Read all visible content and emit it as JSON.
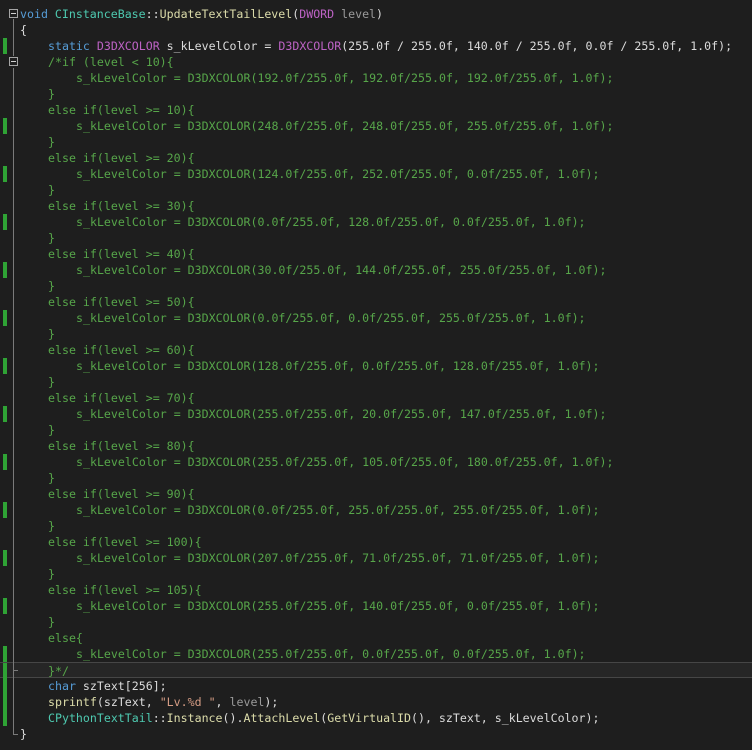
{
  "editor": {
    "lines": [
      {
        "indent": 0,
        "bar": false,
        "fold": "open",
        "tokens": [
          [
            "kw",
            "void"
          ],
          [
            "plain",
            " "
          ],
          [
            "type",
            "CInstanceBase"
          ],
          [
            "plain",
            "::"
          ],
          [
            "fn",
            "UpdateTextTailLevel"
          ],
          [
            "plain",
            "("
          ],
          [
            "mac",
            "DWORD"
          ],
          [
            "plain",
            " "
          ],
          [
            "prm",
            "level"
          ],
          [
            "plain",
            ")"
          ]
        ]
      },
      {
        "indent": 0,
        "bar": false,
        "tokens": [
          [
            "plain",
            "{"
          ]
        ]
      },
      {
        "indent": 1,
        "bar": true,
        "tokens": [
          [
            "kw",
            "static"
          ],
          [
            "plain",
            " "
          ],
          [
            "mac",
            "D3DXCOLOR"
          ],
          [
            "plain",
            " s_kLevelColor = "
          ],
          [
            "mac",
            "D3DXCOLOR"
          ],
          [
            "plain",
            "(255.0f / 255.0f, 140.0f / 255.0f, 0.0f / 255.0f, 1.0f);"
          ]
        ]
      },
      {
        "indent": 1,
        "bar": false,
        "fold": "open",
        "tokens": [
          [
            "cm",
            "/*if (level < 10){"
          ]
        ]
      },
      {
        "indent": 2,
        "bar": false,
        "tokens": [
          [
            "cm",
            "s_kLevelColor = D3DXCOLOR(192.0f/255.0f, 192.0f/255.0f, 192.0f/255.0f, 1.0f);"
          ]
        ]
      },
      {
        "indent": 1,
        "bar": false,
        "tokens": [
          [
            "cm",
            "}"
          ]
        ]
      },
      {
        "indent": 1,
        "bar": false,
        "tokens": [
          [
            "cm",
            "else if(level >= 10){"
          ]
        ]
      },
      {
        "indent": 2,
        "bar": true,
        "tokens": [
          [
            "cm",
            "s_kLevelColor = D3DXCOLOR(248.0f/255.0f, 248.0f/255.0f, 255.0f/255.0f, 1.0f);"
          ]
        ]
      },
      {
        "indent": 1,
        "bar": false,
        "tokens": [
          [
            "cm",
            "}"
          ]
        ]
      },
      {
        "indent": 1,
        "bar": false,
        "tokens": [
          [
            "cm",
            "else if(level >= 20){"
          ]
        ]
      },
      {
        "indent": 2,
        "bar": true,
        "tokens": [
          [
            "cm",
            "s_kLevelColor = D3DXCOLOR(124.0f/255.0f, 252.0f/255.0f, 0.0f/255.0f, 1.0f);"
          ]
        ]
      },
      {
        "indent": 1,
        "bar": false,
        "tokens": [
          [
            "cm",
            "}"
          ]
        ]
      },
      {
        "indent": 1,
        "bar": false,
        "tokens": [
          [
            "cm",
            "else if(level >= 30){"
          ]
        ]
      },
      {
        "indent": 2,
        "bar": true,
        "tokens": [
          [
            "cm",
            "s_kLevelColor = D3DXCOLOR(0.0f/255.0f, 128.0f/255.0f, 0.0f/255.0f, 1.0f);"
          ]
        ]
      },
      {
        "indent": 1,
        "bar": false,
        "tokens": [
          [
            "cm",
            "}"
          ]
        ]
      },
      {
        "indent": 1,
        "bar": false,
        "tokens": [
          [
            "cm",
            "else if(level >= 40){"
          ]
        ]
      },
      {
        "indent": 2,
        "bar": true,
        "tokens": [
          [
            "cm",
            "s_kLevelColor = D3DXCOLOR(30.0f/255.0f, 144.0f/255.0f, 255.0f/255.0f, 1.0f);"
          ]
        ]
      },
      {
        "indent": 1,
        "bar": false,
        "tokens": [
          [
            "cm",
            "}"
          ]
        ]
      },
      {
        "indent": 1,
        "bar": false,
        "tokens": [
          [
            "cm",
            "else if(level >= 50){"
          ]
        ]
      },
      {
        "indent": 2,
        "bar": true,
        "tokens": [
          [
            "cm",
            "s_kLevelColor = D3DXCOLOR(0.0f/255.0f, 0.0f/255.0f, 255.0f/255.0f, 1.0f);"
          ]
        ]
      },
      {
        "indent": 1,
        "bar": false,
        "tokens": [
          [
            "cm",
            "}"
          ]
        ]
      },
      {
        "indent": 1,
        "bar": false,
        "tokens": [
          [
            "cm",
            "else if(level >= 60){"
          ]
        ]
      },
      {
        "indent": 2,
        "bar": true,
        "tokens": [
          [
            "cm",
            "s_kLevelColor = D3DXCOLOR(128.0f/255.0f, 0.0f/255.0f, 128.0f/255.0f, 1.0f);"
          ]
        ]
      },
      {
        "indent": 1,
        "bar": false,
        "tokens": [
          [
            "cm",
            "}"
          ]
        ]
      },
      {
        "indent": 1,
        "bar": false,
        "tokens": [
          [
            "cm",
            "else if(level >= 70){"
          ]
        ]
      },
      {
        "indent": 2,
        "bar": true,
        "tokens": [
          [
            "cm",
            "s_kLevelColor = D3DXCOLOR(255.0f/255.0f, 20.0f/255.0f, 147.0f/255.0f, 1.0f);"
          ]
        ]
      },
      {
        "indent": 1,
        "bar": false,
        "tokens": [
          [
            "cm",
            "}"
          ]
        ]
      },
      {
        "indent": 1,
        "bar": false,
        "tokens": [
          [
            "cm",
            "else if(level >= 80){"
          ]
        ]
      },
      {
        "indent": 2,
        "bar": true,
        "tokens": [
          [
            "cm",
            "s_kLevelColor = D3DXCOLOR(255.0f/255.0f, 105.0f/255.0f, 180.0f/255.0f, 1.0f);"
          ]
        ]
      },
      {
        "indent": 1,
        "bar": false,
        "tokens": [
          [
            "cm",
            "}"
          ]
        ]
      },
      {
        "indent": 1,
        "bar": false,
        "tokens": [
          [
            "cm",
            "else if(level >= 90){"
          ]
        ]
      },
      {
        "indent": 2,
        "bar": true,
        "tokens": [
          [
            "cm",
            "s_kLevelColor = D3DXCOLOR(0.0f/255.0f, 255.0f/255.0f, 255.0f/255.0f, 1.0f);"
          ]
        ]
      },
      {
        "indent": 1,
        "bar": false,
        "tokens": [
          [
            "cm",
            "}"
          ]
        ]
      },
      {
        "indent": 1,
        "bar": false,
        "tokens": [
          [
            "cm",
            "else if(level >= 100){"
          ]
        ]
      },
      {
        "indent": 2,
        "bar": true,
        "tokens": [
          [
            "cm",
            "s_kLevelColor = D3DXCOLOR(207.0f/255.0f, 71.0f/255.0f, 71.0f/255.0f, 1.0f);"
          ]
        ]
      },
      {
        "indent": 1,
        "bar": false,
        "tokens": [
          [
            "cm",
            "}"
          ]
        ]
      },
      {
        "indent": 1,
        "bar": false,
        "tokens": [
          [
            "cm",
            "else if(level >= 105){"
          ]
        ]
      },
      {
        "indent": 2,
        "bar": true,
        "tokens": [
          [
            "cm",
            "s_kLevelColor = D3DXCOLOR(255.0f/255.0f, 140.0f/255.0f, 0.0f/255.0f, 1.0f);"
          ]
        ]
      },
      {
        "indent": 1,
        "bar": false,
        "tokens": [
          [
            "cm",
            "}"
          ]
        ]
      },
      {
        "indent": 1,
        "bar": false,
        "tokens": [
          [
            "cm",
            "else{"
          ]
        ]
      },
      {
        "indent": 2,
        "bar": true,
        "tokens": [
          [
            "cm",
            "s_kLevelColor = D3DXCOLOR(255.0f/255.0f, 0.0f/255.0f, 0.0f/255.0f, 1.0f);"
          ]
        ]
      },
      {
        "indent": 1,
        "bar": true,
        "current": true,
        "tokens": [
          [
            "cm",
            "}*/"
          ]
        ]
      },
      {
        "indent": 1,
        "bar": true,
        "tokens": [
          [
            "kw",
            "char"
          ],
          [
            "plain",
            " szText[256];"
          ]
        ]
      },
      {
        "indent": 1,
        "bar": true,
        "tokens": [
          [
            "fn",
            "sprintf"
          ],
          [
            "plain",
            "(szText, "
          ],
          [
            "str",
            "\"Lv.%d \""
          ],
          [
            "plain",
            ", "
          ],
          [
            "prm",
            "level"
          ],
          [
            "plain",
            ");"
          ]
        ]
      },
      {
        "indent": 1,
        "bar": true,
        "tokens": [
          [
            "type",
            "CPythonTextTail"
          ],
          [
            "plain",
            "::"
          ],
          [
            "fn",
            "Instance"
          ],
          [
            "plain",
            "()."
          ],
          [
            "fn",
            "AttachLevel"
          ],
          [
            "plain",
            "("
          ],
          [
            "fn",
            "GetVirtualID"
          ],
          [
            "plain",
            "(), szText, s_kLevelColor);"
          ]
        ]
      },
      {
        "indent": 0,
        "bar": false,
        "tokens": [
          [
            "plain",
            "}"
          ]
        ]
      }
    ]
  }
}
